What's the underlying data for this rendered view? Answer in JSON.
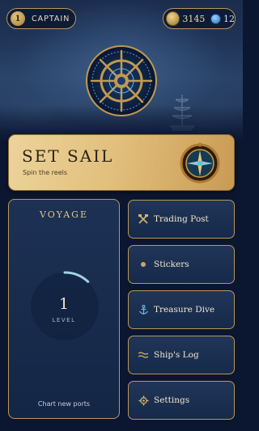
{
  "header": {
    "rank_level": "1",
    "rank_title": "CAPTAIN",
    "gold": "3145",
    "gems": "12"
  },
  "set_sail": {
    "title": "SET SAIL",
    "subtitle": "Spin the reels"
  },
  "voyage": {
    "title": "VOYAGE",
    "level": "1",
    "level_label": "LEVEL",
    "level_progress": 0.12,
    "caption": "Chart new ports"
  },
  "menu": [
    {
      "label": "Trading Post",
      "icon": "crossed-hammers-icon"
    },
    {
      "label": "Stickers",
      "icon": "dot-icon"
    },
    {
      "label": "Treasure Dive",
      "icon": "anchor-icon"
    },
    {
      "label": "Ship's Log",
      "icon": "waves-icon"
    },
    {
      "label": "Settings",
      "icon": "gear-icon"
    }
  ],
  "colors": {
    "background": "#0b1630",
    "gold_border": "#b9975a",
    "set_sail_gold": "#e2c07d",
    "panel": "#182c4e",
    "progress_arc": "#9fd3e0"
  }
}
